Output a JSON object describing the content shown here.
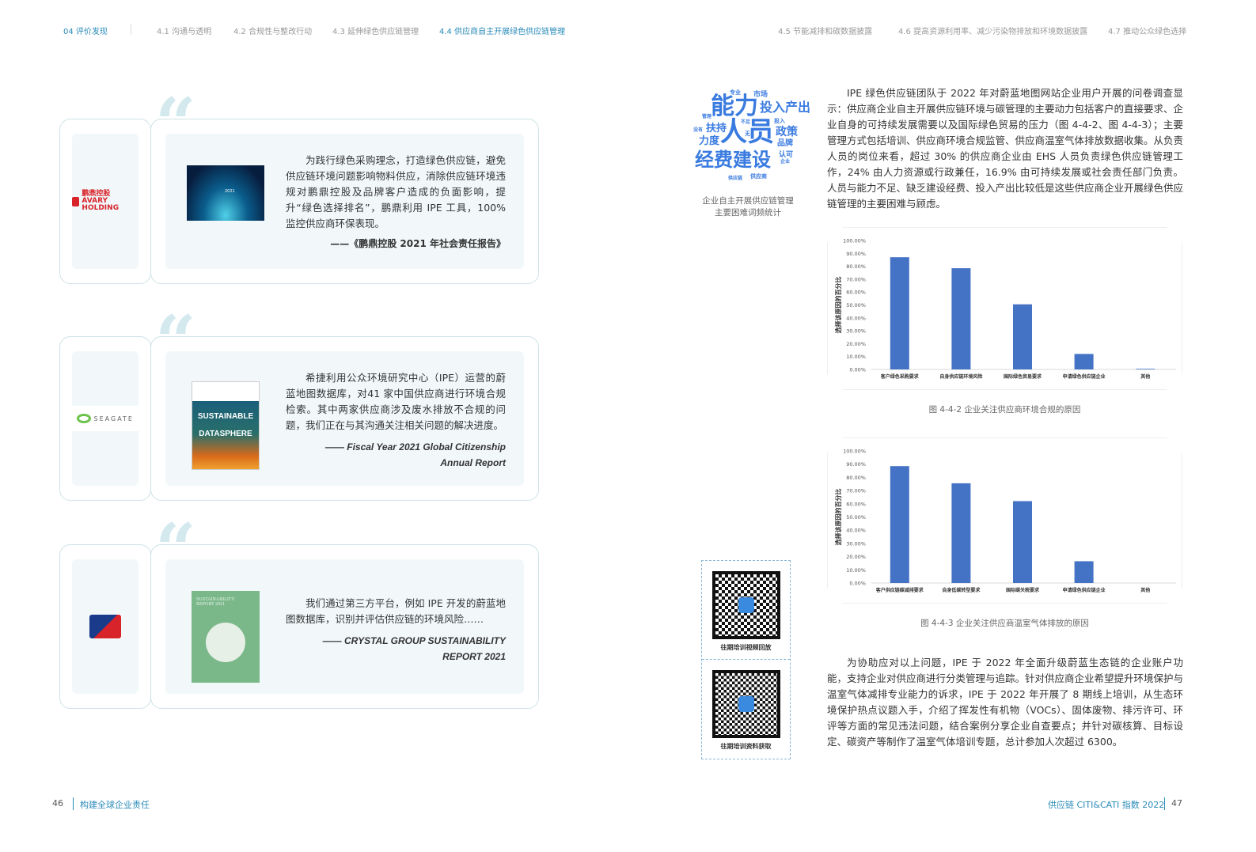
{
  "nav": {
    "section": "04 评价发现",
    "left_items": [
      "4.1 沟通与透明",
      "4.2 合规性与整改行动",
      "4.3 延伸绿色供应链管理",
      "4.4 供应商自主开展绿色供应链管理"
    ],
    "right_items": [
      "4.5 节能减排和碳数据披露",
      "4.6 提高资源利用率、减少污染物排放和环境数据披露",
      "4.7 推动公众绿色选择"
    ],
    "active": "4.4 供应商自主开展绿色供应链管理"
  },
  "quotes": [
    {
      "logo": "鹏鼎控股 AVARY HOLDING",
      "text": "为践行绿色采购理念，打造绿色供应链，避免供应链环境问题影响物料供应，消除供应链环境违规对鹏鼎控股及品牌客户造成的负面影响，提升“绿色选择排名”，鹏鼎利用 IPE 工具，100% 监控供应商环保表现。",
      "source": "——《鹏鼎控股 2021 年社会责任报告》",
      "cover_text": "2021"
    },
    {
      "logo": "SEAGATE",
      "text": "希捷利用公众环境研究中心（IPE）运营的蔚蓝地图数据库，对41 家中国供应商进行环境合规检索。其中两家供应商涉及废水排放不合规的问题，我们正在与其沟通关注相关问题的解决进度。",
      "source_line1": "—— Fiscal Year 2021 Global Citizenship",
      "source_line2": "Annual Report",
      "cover_title1": "SUSTAINABLE",
      "cover_title2": "DATASPHERE"
    },
    {
      "logo": "Crystal Group",
      "text": "我们通过第三方平台，例如 IPE 开发的蔚蓝地图数据库，识别并评估供应链的环境风险……",
      "source_line1": "—— CRYSTAL GROUP SUSTAINABILITY",
      "source_line2": "REPORT 2021",
      "cover_title": "SUSTAINABILITY REPORT 2021"
    }
  ],
  "wordcloud": {
    "words": [
      "能力",
      "投入产出",
      "人员",
      "经费建设",
      "扶持",
      "力度",
      "政策",
      "品牌",
      "市场",
      "专业",
      "管理",
      "没有",
      "不足",
      "无",
      "投入",
      "认可",
      "企业",
      "供应链",
      "供应商"
    ],
    "caption_line1": "企业自主开展供应链管理",
    "caption_line2": "主要困难词频统计"
  },
  "intro_text": "IPE 绿色供应链团队于 2022 年对蔚蓝地图网站企业用户开展的问卷调查显示：供应商企业自主开展供应链环境与碳管理的主要动力包括客户的直接要求、企业自身的可持续发展需要以及国际绿色贸易的压力（图 4-4-2、图 4-4-3）；主要管理方式包括培训、供应商环境合规监管、供应商温室气体排放数据收集。从负责人员的岗位来看，超过 30% 的供应商企业由 EHS 人员负责绿色供应链管理工作，24% 由人力资源或行政兼任，16.9% 由可持续发展或社会责任部门负责。人员与能力不足、缺乏建设经费、投入产出比较低是这些供应商企业开展绿色供应链管理的主要困难与顾虑。",
  "chart_data": [
    {
      "type": "bar",
      "title": "图 4-4-2  企业关注供应商环境合规的原因",
      "ylabel": "选择该原因的百分比",
      "xlabel": "",
      "ylim": [
        0,
        100
      ],
      "yticks": [
        "0.00%",
        "10.00%",
        "20.00%",
        "30.00%",
        "40.00%",
        "50.00%",
        "60.00%",
        "70.00%",
        "80.00%",
        "90.00%",
        "100.00%"
      ],
      "categories": [
        "客户绿色采购要求",
        "自身供应链环境风险",
        "国际绿色贸易要求",
        "申请绿色供应链企业",
        "其他"
      ],
      "values": [
        87,
        78.5,
        50.5,
        12,
        0.5
      ],
      "color": "#4472c4",
      "grid": false
    },
    {
      "type": "bar",
      "title": "图 4-4-3  企业关注供应商温室气体排放的原因",
      "ylabel": "选择该原因的百分比",
      "xlabel": "",
      "ylim": [
        0,
        100
      ],
      "yticks": [
        "0.00%",
        "10.00%",
        "20.00%",
        "30.00%",
        "40.00%",
        "50.00%",
        "60.00%",
        "70.00%",
        "80.00%",
        "90.00%",
        "100.00%"
      ],
      "categories": [
        "客户供应链碳减排要求",
        "自身低碳转型要求",
        "国际碳关税要求",
        "申请绿色供应链企业",
        "其他"
      ],
      "values": [
        88.5,
        75.5,
        62,
        16.5,
        0
      ],
      "color": "#4472c4",
      "grid": false
    }
  ],
  "qr": [
    {
      "label": "往期培训视频回放"
    },
    {
      "label": "往期培训资料获取"
    }
  ],
  "training_text": "为协助应对以上问题，IPE 于 2022 年全面升级蔚蓝生态链的企业账户功能，支持企业对供应商进行分类管理与追踪。针对供应商企业希望提升环境保护与温室气体减排专业能力的诉求，IPE 于 2022 年开展了 8 期线上培训，从生态环境保护热点议题入手，介绍了挥发性有机物（VOCs）、固体废物、排污许可、环评等方面的常见违法问题，结合案例分享企业自查要点；并针对碳核算、目标设定、碳资产等制作了温室气体培训专题，总计参加人次超过 6300。",
  "footer": {
    "left_page": "46",
    "left_title": "构建全球企业责任",
    "right_title": "供应链 CITI&CATI 指数 2022",
    "right_page": "47"
  },
  "colors": {
    "accent": "#2a8bb8",
    "bar": "#4472c4",
    "card_border": "#cfe3e6",
    "panel": "#f2f8fa"
  }
}
